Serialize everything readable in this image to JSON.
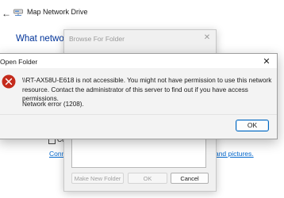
{
  "wizard": {
    "back_glyph": "←",
    "title": "Map Network Drive",
    "heading": "What network",
    "checkbox_label": "Co",
    "link_left": "Conne",
    "link_right": "ts and pictures."
  },
  "browse_dialog": {
    "title": "Browse For Folder",
    "close_glyph": "✕",
    "new_folder_label": "Make New Folder",
    "ok_label": "OK",
    "cancel_label": "Cancel"
  },
  "error_dialog": {
    "title": "Open Folder",
    "close_glyph": "✕",
    "icon": "error-x-icon",
    "message": "\\\\RT-AX58U-E618 is not accessible. You might not have permission to use this network resource. Contact the administrator of this server to find out if you have access permissions.",
    "error_code": "Network error (1208).",
    "ok_label": "OK"
  },
  "colors": {
    "error_icon": "#c42b1c",
    "link": "#0066cc",
    "heading": "#003399",
    "focus_border": "#0067c0"
  }
}
